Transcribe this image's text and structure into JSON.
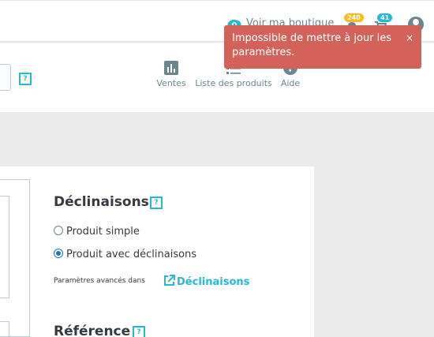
{
  "header": {
    "view_shop": "Voir ma boutique",
    "orders_count": "240",
    "customers_count": "41"
  },
  "toolbar": {
    "sales": "Ventes",
    "products_list": "Liste des produits",
    "help": "Aide"
  },
  "help_badge": "?",
  "variants": {
    "title": "Déclinaisons",
    "option_simple": "Produit simple",
    "option_combinations": "Produit avec déclinaisons",
    "selected": "Produit avec déclinaisons",
    "advanced_label": "Paramètres avancés dans",
    "advanced_link": "Déclinaisons"
  },
  "reference": {
    "title": "Référence"
  },
  "toast": {
    "message": "Impossible de mettre à jour les paramètres.",
    "close": "×"
  },
  "colors": {
    "accent": "#25b9d7",
    "error": "#d3625b",
    "badge_orders": "#fbbb22"
  }
}
